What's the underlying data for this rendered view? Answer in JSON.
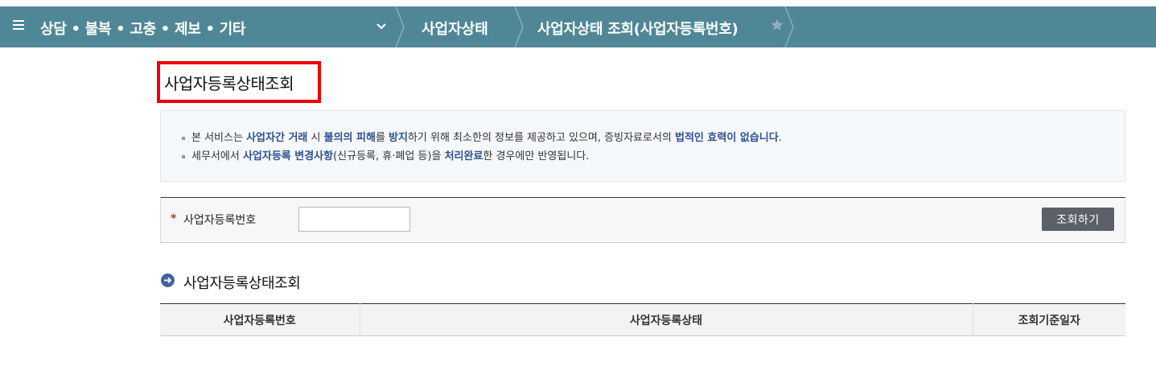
{
  "nav": {
    "category": "상담 • 불복 • 고충 • 제보 • 기타",
    "crumb1": "사업자상태",
    "crumb2": "사업자상태 조회(사업자등록번호)"
  },
  "page": {
    "title": "사업자등록상태조회"
  },
  "notice": {
    "line1": [
      {
        "t": "본 서비스는 ",
        "b": false
      },
      {
        "t": "사업자간 거래",
        "b": true
      },
      {
        "t": " 시 ",
        "b": false
      },
      {
        "t": "불의의 피해",
        "b": true
      },
      {
        "t": "를 ",
        "b": false
      },
      {
        "t": "방지",
        "b": true
      },
      {
        "t": "하기 위해 최소한의 정보를 제공하고 있으며, 증빙자료로서의 ",
        "b": false
      },
      {
        "t": "법적인 효력이 없습니다",
        "b": true
      },
      {
        "t": ".",
        "b": false
      }
    ],
    "line2": [
      {
        "t": "세무서에서 ",
        "b": false
      },
      {
        "t": "사업자등록 변경사항",
        "b": true
      },
      {
        "t": "(신규등록, 휴·폐업 등)을 ",
        "b": false
      },
      {
        "t": "처리완료",
        "b": true
      },
      {
        "t": "한 경우에만 반영됩니다.",
        "b": false
      }
    ]
  },
  "form": {
    "required_mark": "*",
    "field_label": "사업자등록번호",
    "field_value": "",
    "field_placeholder": "",
    "search_label": "조회하기"
  },
  "result": {
    "section_title": "사업자등록상태조회",
    "columns": [
      "사업자등록번호",
      "사업자등록상태",
      "조회기준일자"
    ]
  },
  "icons": {
    "menu": "hamburger-icon",
    "dropdown": "chevron-down-icon",
    "star": "star-icon",
    "section": "arrow-circle-icon"
  },
  "colors": {
    "nav_bg": "#4f8797",
    "highlight_text": "#2f5191",
    "title_border": "#ee0000",
    "button_bg": "#5c6069"
  }
}
